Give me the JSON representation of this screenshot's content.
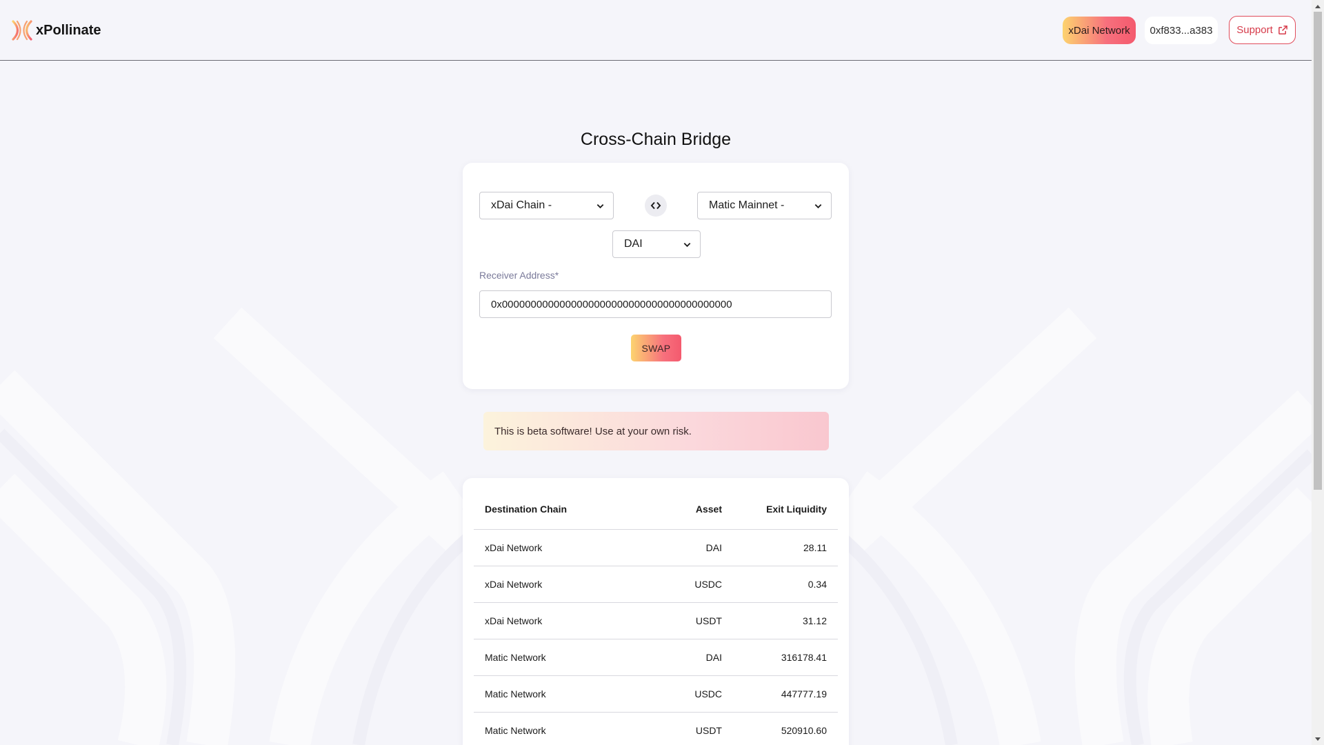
{
  "header": {
    "app_name": "xPollinate",
    "network_label": "xDai Network",
    "address_label": "0xf833...a383",
    "support_label": "Support"
  },
  "main": {
    "title": "Cross-Chain Bridge",
    "from_chain": "xDai Chain -",
    "to_chain": "Matic Mainnet -",
    "asset": "DAI",
    "receiver_label": "Receiver Address*",
    "receiver_value": "0x0000000000000000000000000000000000000000",
    "swap_label": "SWAP",
    "beta_warning": "This is beta software! Use at your own risk."
  },
  "table": {
    "headers": [
      "Destination Chain",
      "Asset",
      "Exit Liquidity"
    ],
    "rows": [
      [
        "xDai Network",
        "DAI",
        "28.11"
      ],
      [
        "xDai Network",
        "USDC",
        "0.34"
      ],
      [
        "xDai Network",
        "USDT",
        "31.12"
      ],
      [
        "Matic Network",
        "DAI",
        "316178.41"
      ],
      [
        "Matic Network",
        "USDC",
        "447777.19"
      ],
      [
        "Matic Network",
        "USDT",
        "520910.60"
      ]
    ]
  },
  "colors": {
    "accent_gradient_start": "#fcd36f",
    "accent_gradient_end": "#f45a6e",
    "support_border": "#e04b5a",
    "background": "#f5f5fa"
  },
  "icons": {
    "logo": "xpollinate-logo-icon",
    "external_link": "external-link-icon",
    "swap_direction": "swap-arrows-icon",
    "dropdown": "chevron-down-icon"
  }
}
